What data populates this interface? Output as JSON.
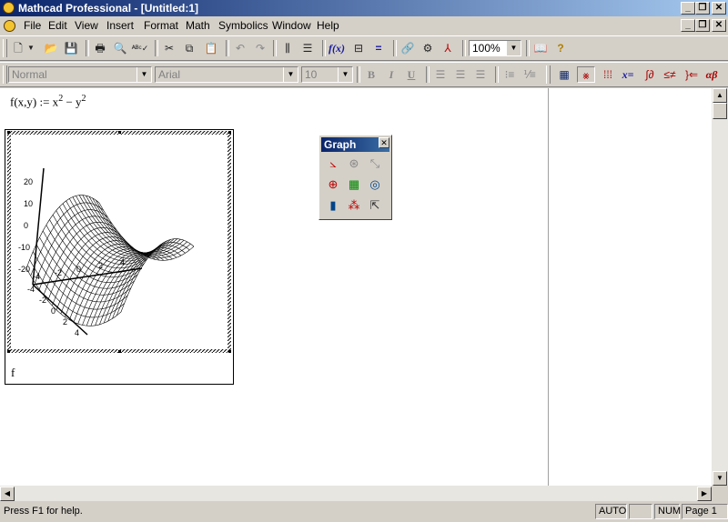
{
  "window": {
    "title": "Mathcad Professional - [Untitled:1]"
  },
  "menubar": {
    "items": [
      "File",
      "Edit",
      "View",
      "Insert",
      "Format",
      "Math",
      "Symbolics",
      "Window",
      "Help"
    ]
  },
  "toolbar_standard": {
    "zoom": "100%"
  },
  "toolbar_formatting": {
    "style": "Normal",
    "font": "Arial",
    "size": "10",
    "bold": "B",
    "italic": "I",
    "underline": "U"
  },
  "math_toolbar": {
    "eval_label": "x=",
    "greek_label": "αβ"
  },
  "worksheet": {
    "formula": {
      "lhs": "f(x,y) := x",
      "exp1": "2",
      "minus": " − y",
      "exp2": "2"
    },
    "plot_label": "f",
    "z_ticks": [
      "20",
      "10",
      "0",
      "-10",
      "-20"
    ],
    "x_ticks": [
      "-4",
      "-2",
      "0",
      "2",
      "4"
    ],
    "y_ticks": [
      "4",
      "2",
      "0",
      "-2",
      "-4"
    ]
  },
  "graph_palette": {
    "title": "Graph"
  },
  "statusbar": {
    "help": "Press F1 for help.",
    "mode": "AUTO",
    "num": "NUM",
    "page": "Page 1"
  },
  "colors": {
    "title_start": "#0a246a",
    "title_end": "#a6caf0",
    "chrome": "#d4d0c8"
  }
}
